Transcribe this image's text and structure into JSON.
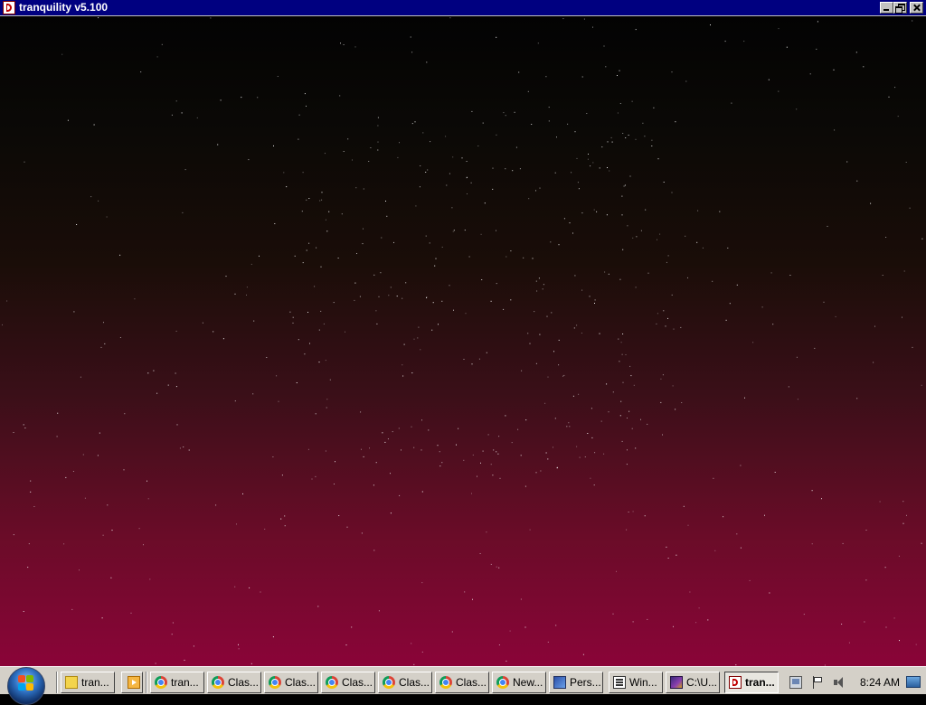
{
  "window": {
    "title": "tranquility v5.100",
    "icon": "tranquility-app-icon",
    "controls": {
      "minimize": "minimize-icon",
      "restore": "restore-icon",
      "close": "close-icon"
    }
  },
  "scene": {
    "description_colors": {
      "top": "#030303",
      "middle": "#1a0d08",
      "bottom": "#8a0438"
    },
    "star_color": "#ffffff"
  },
  "taskbar": {
    "start": {
      "icon": "windows-start-orb-icon"
    },
    "tasks": [
      {
        "label": "tran...",
        "icon": "folder-icon",
        "active": false
      },
      {
        "label": "",
        "icon": "media-player-icon",
        "active": false
      },
      {
        "label": "tran...",
        "icon": "chrome-icon",
        "active": false
      },
      {
        "label": "Clas...",
        "icon": "chrome-icon",
        "active": false
      },
      {
        "label": "Clas...",
        "icon": "chrome-icon",
        "active": false
      },
      {
        "label": "Clas...",
        "icon": "chrome-icon",
        "active": false
      },
      {
        "label": "Clas...",
        "icon": "chrome-icon",
        "active": false
      },
      {
        "label": "Clas...",
        "icon": "chrome-icon",
        "active": false
      },
      {
        "label": "New...",
        "icon": "chrome-icon",
        "active": false
      },
      {
        "label": "Pers...",
        "icon": "personalization-icon",
        "active": false
      },
      {
        "label": "Win...",
        "icon": "window-icon",
        "active": false
      },
      {
        "label": "C:\\U...",
        "icon": "command-prompt-icon",
        "active": false
      },
      {
        "label": "tran...",
        "icon": "tranquility-app-icon",
        "active": true
      }
    ],
    "tray": {
      "icons": [
        "network-icon",
        "action-center-flag-icon",
        "volume-icon"
      ],
      "clock": "8:24 AM",
      "show_desktop": "show-desktop-icon"
    }
  }
}
